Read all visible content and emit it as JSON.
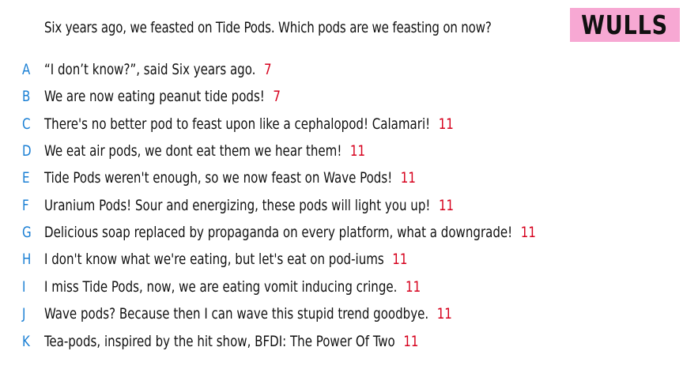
{
  "question": "Six years ago, we feasted on Tide Pods. Which pods are we feasting on now?",
  "logo": "WULLS",
  "colors": {
    "letter": "#1a7fd4",
    "score": "#d6001c",
    "logo_bg": "#f7a8d3"
  },
  "answers": [
    {
      "letter": "A",
      "text": "“I don’t know?”, said Six years ago.",
      "score": "7"
    },
    {
      "letter": "B",
      "text": "We are now eating peanut tide pods!",
      "score": "7"
    },
    {
      "letter": "C",
      "text": "There's no better pod to feast upon like a cephalopod! Calamari!",
      "score": "11"
    },
    {
      "letter": "D",
      "text": "We eat air pods, we dont eat them we hear them!",
      "score": "11"
    },
    {
      "letter": "E",
      "text": "Tide Pods weren't enough, so we now feast on Wave Pods!",
      "score": "11"
    },
    {
      "letter": "F",
      "text": "Uranium Pods! Sour and energizing, these pods will light you up!",
      "score": "11"
    },
    {
      "letter": "G",
      "text": "Delicious soap replaced by propaganda on every platform, what a downgrade!",
      "score": "11"
    },
    {
      "letter": "H",
      "text": "I don't know what we're eating, but let's eat on pod-iums",
      "score": "11"
    },
    {
      "letter": "I",
      "text": "I miss Tide Pods, now, we are eating vomit inducing cringe.",
      "score": "11"
    },
    {
      "letter": "J",
      "text": "Wave pods? Because then I can wave this stupid trend goodbye.",
      "score": "11"
    },
    {
      "letter": "K",
      "text": "Tea-pods, inspired by the hit show, BFDI: The Power Of Two",
      "score": "11"
    }
  ]
}
